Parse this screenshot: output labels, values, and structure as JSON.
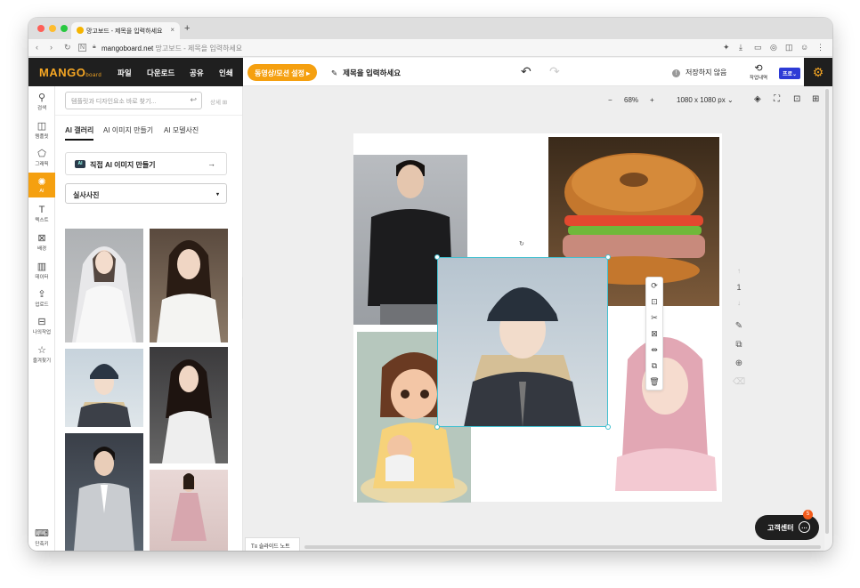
{
  "browser": {
    "tab_title": "망고보드 - 제목을 입력하세요",
    "new_tab": "+",
    "url_domain": "mangoboard.net",
    "url_page_title": "망고보드 - 제목을 입력하세요"
  },
  "header": {
    "logo": "MANGO",
    "logo_sub": "board",
    "menu": [
      "파일",
      "다운로드",
      "공유",
      "인쇄"
    ],
    "video_button": "동영상/모션 설정 ▸",
    "title_placeholder": "제목을 입력하세요",
    "save_status": "저장하지 않음",
    "save_status_icon": "!",
    "history_label": "작업내역",
    "pro_badge": "프로⌄"
  },
  "rail": [
    {
      "label": "검색",
      "icon": "search-icon",
      "glyph": "⚲"
    },
    {
      "label": "템플릿",
      "icon": "template-icon",
      "glyph": "◫"
    },
    {
      "label": "그래픽",
      "icon": "graphic-icon",
      "glyph": "⬠"
    },
    {
      "label": "AI",
      "icon": "ai-icon",
      "glyph": "✺"
    },
    {
      "label": "텍스트",
      "icon": "text-icon",
      "glyph": "T"
    },
    {
      "label": "배경",
      "icon": "background-icon",
      "glyph": "⊠"
    },
    {
      "label": "데이터",
      "icon": "chart-icon",
      "glyph": "▥"
    },
    {
      "label": "업로드",
      "icon": "upload-icon",
      "glyph": "⇪"
    },
    {
      "label": "나의작업",
      "icon": "myworks-icon",
      "glyph": "⊟"
    },
    {
      "label": "즐겨찾기",
      "icon": "star-icon",
      "glyph": "☆"
    },
    {
      "label": "단축키",
      "icon": "keyboard-icon",
      "glyph": "⌨"
    }
  ],
  "panel": {
    "search_placeholder": "템플릿과 디자인요소 바로 찾기...",
    "detail_label": "상세",
    "tabs": [
      "AI 갤러리",
      "AI 이미지 만들기",
      "AI 모델사진"
    ],
    "make_button": "직접 AI 이미지 만들기",
    "make_badge": "AI",
    "dropdown_value": "실사사진"
  },
  "canvas": {
    "zoom": "68%",
    "zoom_minus": "−",
    "zoom_plus": "+",
    "size": "1080 x 1080 px",
    "page_number": "1",
    "slide_note": "슬라이드 노트"
  },
  "help": {
    "label": "고객센터",
    "badge": "5"
  },
  "colors": {
    "accent": "#f5a010",
    "selection": "#43c0d0",
    "dark": "#1f1f1f",
    "pro": "#2d3bd6"
  }
}
